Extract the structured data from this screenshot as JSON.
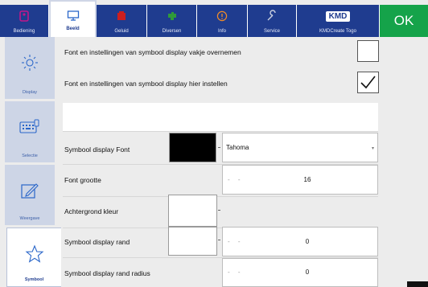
{
  "topbar": {
    "tabs": [
      {
        "label": "Bediening",
        "icon": "remote-icon",
        "active": false
      },
      {
        "label": "Beeld",
        "icon": "monitor-icon",
        "active": true
      },
      {
        "label": "Geluid",
        "icon": "speaker-icon",
        "active": false
      },
      {
        "label": "Diversen",
        "icon": "puzzle-icon",
        "active": false
      },
      {
        "label": "Info",
        "icon": "info-icon",
        "active": false
      },
      {
        "label": "Service",
        "icon": "wrench-icon",
        "active": false
      },
      {
        "label": "KMDCreate Togo",
        "logo_text": "KMD",
        "icon": "kmd-logo",
        "active": false
      }
    ],
    "ok_label": "OK"
  },
  "sidenav": {
    "items": [
      {
        "label": "Display",
        "icon": "sun-icon",
        "active": false
      },
      {
        "label": "Selectie",
        "icon": "keyboard-icon",
        "active": false
      },
      {
        "label": "Weergave",
        "icon": "pen-edit-icon",
        "active": false
      },
      {
        "label": "Symbool",
        "icon": "star-icon",
        "active": true
      }
    ]
  },
  "settings": {
    "take_over_label": "Font en instellingen van symbool display vakje overnemen",
    "take_over_checked": false,
    "set_here_label": "Font en instellingen van symbool display hier instellen",
    "set_here_checked": true,
    "font_label": "Symbool display Font",
    "font_color": "#000000",
    "font_value": "Tahoma",
    "font_size_label": "Font grootte",
    "font_size_value": "16",
    "bg_color_label": "Achtergrond kleur",
    "bg_color": "#ffffff",
    "border_label": "Symbool display rand",
    "border_color": "#ffffff",
    "border_value": "0",
    "radius_label": "Symbool display rand radius",
    "radius_value": "0"
  },
  "colors": {
    "tab_blue": "#1f3c8f",
    "ok_green": "#15a34a",
    "sidenav_bg": "#cdd5e6",
    "icon_magenta": "#c0168a",
    "icon_red": "#cc1f1f",
    "icon_green": "#2f9a3a",
    "icon_orange": "#f28c28",
    "icon_blue": "#2a66c9"
  }
}
